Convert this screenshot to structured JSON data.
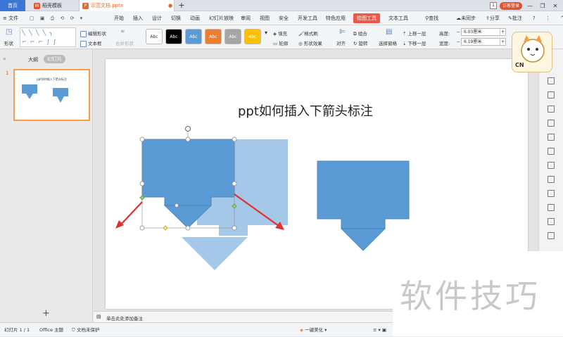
{
  "tabs": {
    "home": "首页",
    "template": "稻壳模板",
    "doc": "示范文档.pptx",
    "add": "+"
  },
  "topright": {
    "page": "1",
    "login": "访客登录",
    "min": "—",
    "max": "❐",
    "close": "✕"
  },
  "menu": {
    "file": "文件",
    "items": [
      "开始",
      "插入",
      "设计",
      "切换",
      "动画",
      "幻灯片放映",
      "审阅",
      "视图",
      "安全",
      "开发工具",
      "特色应用",
      "绘图工具",
      "文本工具"
    ],
    "search": "查找",
    "sync": "未同步",
    "share": "分享",
    "comment": "批注"
  },
  "ribbon": {
    "shape": "形状",
    "edit_shape": "编辑形状",
    "textbox": "文本框",
    "merge": "合并形状",
    "style_label": "Abc",
    "fill": "填充",
    "format_brush": "格式刷",
    "outline": "轮廓",
    "shape_effect": "形状效果",
    "align": "对齐",
    "group": "组合",
    "rotate": "旋转",
    "selection_pane": "选择窗格",
    "up": "上移一层",
    "down": "下移一层",
    "height_label": "高度:",
    "height_val": "6.03厘米",
    "width_label": "宽度:",
    "width_val": "6.19厘米"
  },
  "styles": [
    {
      "bg": "#ffffff",
      "fg": "#333333"
    },
    {
      "bg": "#000000",
      "fg": "#ffffff"
    },
    {
      "bg": "#5b9bd5",
      "fg": "#ffffff"
    },
    {
      "bg": "#ed7d31",
      "fg": "#ffffff"
    },
    {
      "bg": "#a5a5a5",
      "fg": "#ffffff"
    },
    {
      "bg": "#ffc000",
      "fg": "#ffffff"
    }
  ],
  "leftpanel": {
    "outline": "大纲",
    "slides": "幻灯片",
    "slide_num": "1",
    "thumb_title": "ppt如何插入下箭头标注",
    "add": "+"
  },
  "slide": {
    "title": "ppt如何插入下箭头标注"
  },
  "notes": {
    "placeholder": "单击此处添加备注"
  },
  "status": {
    "slide": "幻灯片 1 / 1",
    "theme": "Office 主题",
    "protect": "文档未保护",
    "beautify": "一键美化"
  },
  "watermark": "软件技巧",
  "mascot": "CN",
  "colors": {
    "accent": "#5b9bd5",
    "red_arrow": "#e03030",
    "draw_tab": "#ea5a4a"
  }
}
